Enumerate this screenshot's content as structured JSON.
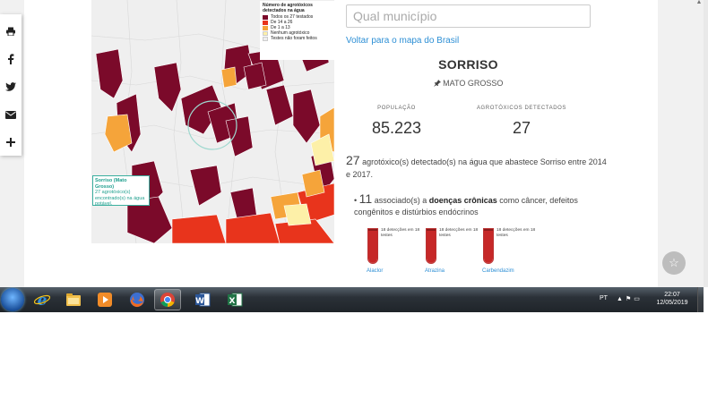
{
  "search": {
    "placeholder": "Qual município"
  },
  "back_link": "Voltar para o mapa do Brasil",
  "city": {
    "name": "SORRISO",
    "state": "MATO GROSSO"
  },
  "stats": {
    "population_label": "POPULAÇÃO",
    "population_value": "85.223",
    "agro_label": "AGROTÓXICOS DETECTADOS",
    "agro_value": "27"
  },
  "summary": {
    "count": "27",
    "text": " agrotóxico(s) detectado(s) na água que abastece Sorriso entre 2014 e 2017."
  },
  "chronic": {
    "count": "11",
    "text_a": " associado(s) a ",
    "bold": "doenças crônicas",
    "text_b": " como câncer, defeitos congênitos e distúrbios endócrinos"
  },
  "tubes": [
    {
      "name": "Alaclor",
      "note": "18 detecções em 18 testes",
      "fill": 1.0
    },
    {
      "name": "Atrazina",
      "note": "18 detecções em 18 testes",
      "fill": 1.0
    },
    {
      "name": "Carbendazim",
      "note": "18 detecções em 18 testes",
      "fill": 1.0
    }
  ],
  "map": {
    "legend": {
      "title": "Número de agrotóxicos detectados na água",
      "items": [
        {
          "label": "Todos os 27 testados",
          "color": "#7b0a2a"
        },
        {
          "label": "De 14 a 26",
          "color": "#e8341c"
        },
        {
          "label": "De 1 a 13",
          "color": "#f5a43a"
        },
        {
          "label": "Nenhum agrotóxico",
          "color": "#fdf0a8"
        },
        {
          "label": "Testes não foram feitos",
          "color": "#eeeeee"
        }
      ]
    },
    "tooltip": {
      "title": "Sorriso (Mato Grosso)",
      "text": "27 agrotóxico(s) encontrado(s) na água potável."
    }
  },
  "share": [
    "print-icon",
    "facebook-icon",
    "twitter-icon",
    "email-icon",
    "plus-icon"
  ],
  "taskbar": {
    "apps": [
      "internet-explorer-icon",
      "file-explorer-icon",
      "media-player-icon",
      "firefox-icon",
      "chrome-icon",
      "word-icon",
      "excel-icon"
    ],
    "language": "PT",
    "time": "22:07",
    "date": "12/05/2019"
  }
}
